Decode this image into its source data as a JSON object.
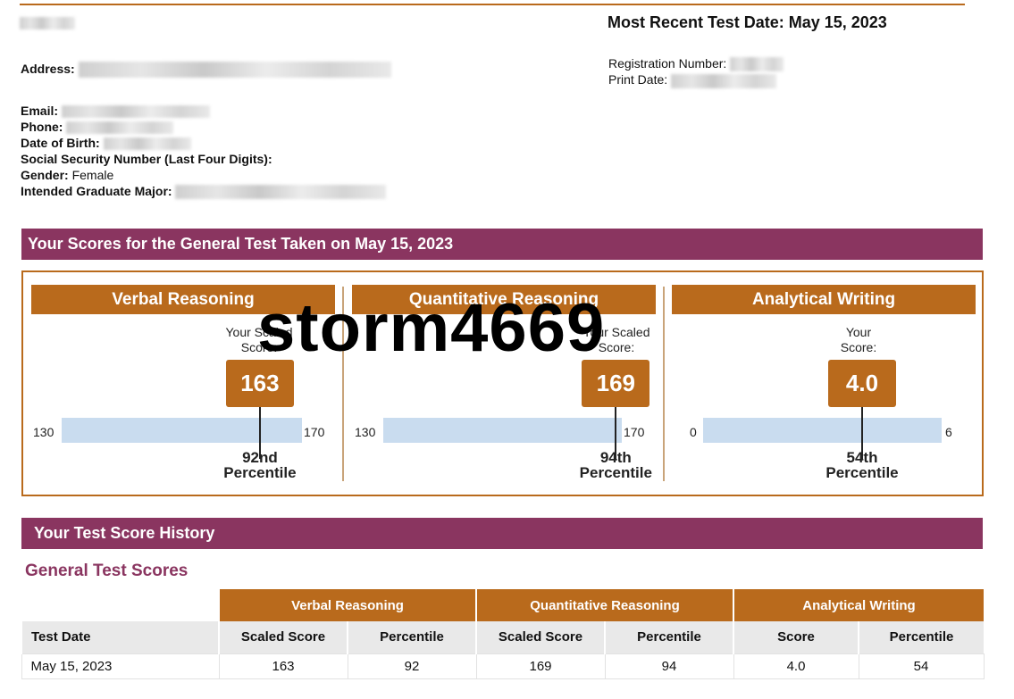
{
  "header": {
    "most_recent_label": "Most Recent Test Date: May 15, 2023",
    "registration_label": "Registration Number:",
    "print_date_label": "Print Date:"
  },
  "candidate": {
    "address_label": "Address:",
    "email_label": "Email:",
    "phone_label": "Phone:",
    "dob_label": "Date of Birth:",
    "ssn_label": "Social Security Number (Last Four Digits):",
    "gender_label": "Gender:",
    "gender_value": "Female",
    "major_label": "Intended Graduate Major:"
  },
  "scores_section": {
    "title": "Your Scores for the General Test Taken on May 15, 2023",
    "panels": [
      {
        "title": "Verbal Reasoning",
        "caption_line1": "Your Scaled",
        "caption_line2": "Score:",
        "score": "163",
        "min": "130",
        "max": "170",
        "percentile_num": "92nd",
        "percentile_word": "Percentile",
        "score_value": 163,
        "range": [
          130,
          170
        ]
      },
      {
        "title": "Quantitative Reasoning",
        "caption_line1": "Your Scaled",
        "caption_line2": "Score:",
        "score": "169",
        "min": "130",
        "max": "170",
        "percentile_num": "94th",
        "percentile_word": "Percentile",
        "score_value": 169,
        "range": [
          130,
          170
        ]
      },
      {
        "title": "Analytical Writing",
        "caption_line1": "Your",
        "caption_line2": "Score:",
        "score": "4.0",
        "min": "0",
        "max": "6",
        "percentile_num": "54th",
        "percentile_word": "Percentile",
        "score_value": 4.0,
        "range": [
          0,
          6
        ]
      }
    ]
  },
  "history": {
    "title": "Your Test Score History",
    "subtitle": "General Test Scores",
    "groups": [
      "Verbal Reasoning",
      "Quantitative Reasoning",
      "Analytical Writing"
    ],
    "columns": [
      "Test Date",
      "Scaled Score",
      "Percentile",
      "Scaled Score",
      "Percentile",
      "Score",
      "Percentile"
    ],
    "rows": [
      [
        "May 15, 2023",
        "163",
        "92",
        "169",
        "94",
        "4.0",
        "54"
      ]
    ]
  },
  "watermark": "storm4669",
  "colors": {
    "banner": "#8a3560",
    "accent": "#b96a1c",
    "bar": "#c9dcef"
  }
}
